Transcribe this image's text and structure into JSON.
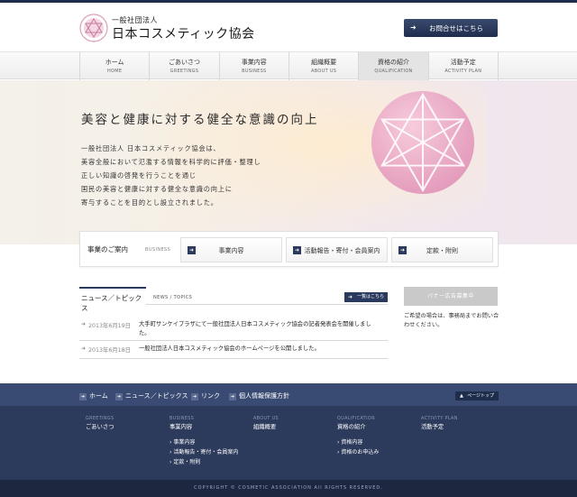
{
  "header": {
    "logo_sub": "一般社団法人",
    "logo_main": "日本コスメティック協会",
    "contact_label": "お問合せはこちら"
  },
  "nav": [
    {
      "jp": "ホーム",
      "en": "HOME"
    },
    {
      "jp": "ごあいさつ",
      "en": "GREETINGS"
    },
    {
      "jp": "事業内容",
      "en": "BUSINESS"
    },
    {
      "jp": "組織概要",
      "en": "ABOUT US"
    },
    {
      "jp": "資格の紹介",
      "en": "QUALIFICATION"
    },
    {
      "jp": "活動予定",
      "en": "ACTIVITY PLAN"
    }
  ],
  "hero": {
    "title": "美容と健康に対する健全な意識の向上",
    "lines": [
      "一般社団法人 日本コスメティック協会は、",
      "美容全般において氾濫する情報を科学的に評価・整理し",
      "正しい知識の啓発を行うことを通じ",
      "国民の美容と健康に対する健全な意識の向上に",
      "寄与することを目的とし設立されました。"
    ]
  },
  "business": {
    "title": "事業のご案内",
    "en": "BUSINESS",
    "buttons": [
      "事業内容",
      "活動報告・寄付・会員案内",
      "定款・附則"
    ]
  },
  "news": {
    "tab": "ニュース／トピックス",
    "en": "NEWS / TOPICS",
    "all_label": "一覧はこちら",
    "items": [
      {
        "date": "2013年6月19日",
        "text": "大手町サンケイプラザにて一般社団法人日本コスメティック協会の記者発表会を開催しました。"
      },
      {
        "date": "2013年6月18日",
        "text": "一般社団法人日本コスメティック協会のホームページを公開しました。"
      }
    ]
  },
  "banner": {
    "label": "バナー広告募集中",
    "note": "ご希望の場合は、事務局までお問い合わせください。"
  },
  "footer_links": [
    "ホーム",
    "ニュース／トピックス",
    "リンク",
    "個人情報保護方針"
  ],
  "pagetop_label": "ページトップ",
  "sitemap": [
    {
      "en": "GREETINGS",
      "jp": "ごあいさつ",
      "subs": []
    },
    {
      "en": "BUSINESS",
      "jp": "事業内容",
      "subs": [
        "事業内容",
        "活動報告・寄付・会員案内",
        "定款・附則"
      ]
    },
    {
      "en": "ABOUT US",
      "jp": "組織概要",
      "subs": []
    },
    {
      "en": "QUALIFICATION",
      "jp": "資格の紹介",
      "subs": [
        "資格内容",
        "資格のお申込み"
      ]
    },
    {
      "en": "ACTIVITY PLAN",
      "jp": "活動予定",
      "subs": []
    }
  ],
  "copyright": "COPYRIGHT © COSMETIC ASSOCIATION All RIGHTS RESERVED.",
  "colors": {
    "navy": "#2c3a5c",
    "accent_pink": "#e4a6c4"
  }
}
